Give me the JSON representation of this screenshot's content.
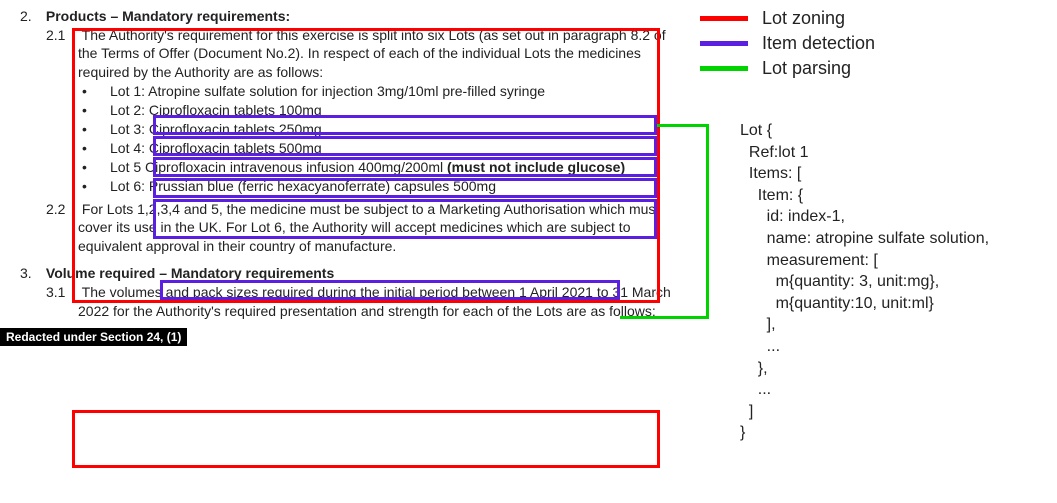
{
  "sections": {
    "s2": {
      "num": "2.",
      "title": "Products – Mandatory requirements:",
      "p21_num": "2.1",
      "p21_text": "The Authority's requirement for this exercise is split into six Lots (as set out in paragraph 8.2 of the Terms of Offer (Document No.2). In respect of each of the individual Lots the medicines required by the Authority are as follows:",
      "lots": [
        {
          "label": "Lot 1:",
          "item_pre": "Atropine sulfate solution for injection 3mg/10ml pre-filled syringe",
          "item_bold": ""
        },
        {
          "label": "Lot 2:",
          "item_pre": "Ciprofloxacin tablets 100mg",
          "item_bold": ""
        },
        {
          "label": "Lot 3:",
          "item_pre": "Ciprofloxacin tablets 250mg",
          "item_bold": ""
        },
        {
          "label": "Lot 4:",
          "item_pre": "Ciprofloxacin tablets 500mg",
          "item_bold": ""
        },
        {
          "label": "Lot 5",
          "item_pre": " Ciprofloxacin intravenous infusion 400mg/200ml ",
          "item_bold": "(must not include glucose)"
        },
        {
          "label": "Lot 6:",
          "item_pre": "Prussian blue (ferric hexacyanoferrate) capsules 500mg",
          "item_bold": ""
        }
      ],
      "p22_num": "2.2",
      "p22_text": "For Lots 1,2,3,4 and 5, the medicine must be subject to a Marketing Authorisation which must cover its use in the UK. For Lot 6, the Authority will accept medicines which are subject to equivalent approval in their country of manufacture."
    },
    "s3": {
      "num": "3.",
      "title": "Volume required – Mandatory requirements",
      "p31_num": "3.1",
      "p31_text": "The volumes and pack sizes required during the initial period between 1 April 2021 to 31 March 2022 for the Authority's required presentation and strength for each of the Lots are as follows:"
    }
  },
  "redacted": "Redacted under Section 24, (1)",
  "legend": {
    "red": "Lot zoning",
    "purple": "Item detection",
    "green": "Lot parsing"
  },
  "parse": {
    "l1": "Lot {",
    "l2": "  Ref:lot 1",
    "l3": "  Items: [",
    "l4": "    Item: {",
    "l5": "      id: index-1,",
    "l6": "      name: atropine sulfate solution,",
    "l7": "      measurement: [",
    "l8": "        m{quantity: 3, unit:mg},",
    "l9": "        m{quantity:10, unit:ml}",
    "l10": "      ],",
    "l11": "      ...",
    "l12": "    },",
    "l13": "    ...",
    "l14": "  ]",
    "l15": "}"
  },
  "chart_data": {
    "type": "table",
    "title": "Lot parsing example",
    "lots": [
      {
        "ref": "Lot 1",
        "item": "Atropine sulfate solution for injection 3mg/10ml pre-filled syringe"
      },
      {
        "ref": "Lot 2",
        "item": "Ciprofloxacin tablets 100mg"
      },
      {
        "ref": "Lot 3",
        "item": "Ciprofloxacin tablets 250mg"
      },
      {
        "ref": "Lot 4",
        "item": "Ciprofloxacin tablets 500mg"
      },
      {
        "ref": "Lot 5",
        "item": "Ciprofloxacin intravenous infusion 400mg/200ml (must not include glucose)"
      },
      {
        "ref": "Lot 6",
        "item": "Prussian blue (ferric hexacyanoferrate) capsules 500mg"
      }
    ],
    "parsed_example": {
      "Ref": "lot 1",
      "Items": [
        {
          "id": "index-1",
          "name": "atropine sulfate solution",
          "measurement": [
            {
              "quantity": 3,
              "unit": "mg"
            },
            {
              "quantity": 10,
              "unit": "ml"
            }
          ]
        }
      ]
    }
  }
}
